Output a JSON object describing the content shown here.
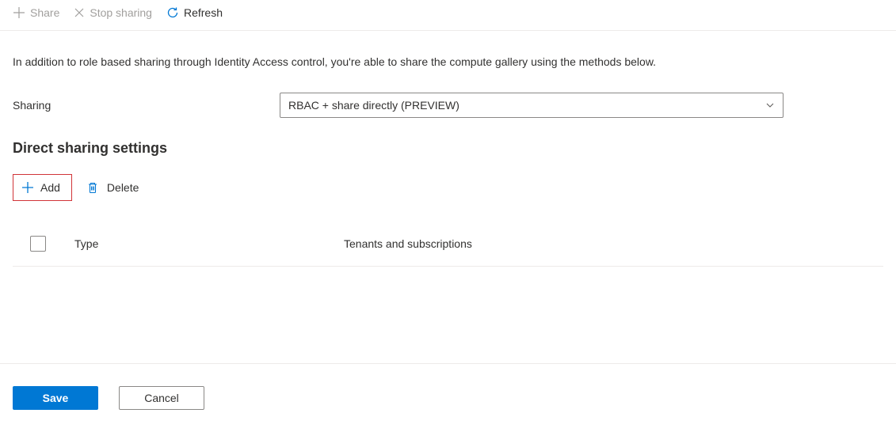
{
  "toolbar": {
    "share_label": "Share",
    "stop_sharing_label": "Stop sharing",
    "refresh_label": "Refresh"
  },
  "description": "In addition to role based sharing through Identity Access control, you're able to share the compute gallery using the methods below.",
  "sharing": {
    "label": "Sharing",
    "selected": "RBAC + share directly (PREVIEW)"
  },
  "section": {
    "heading": "Direct sharing settings",
    "add_label": "Add",
    "delete_label": "Delete"
  },
  "table": {
    "col_type": "Type",
    "col_tenants": "Tenants and subscriptions"
  },
  "footer": {
    "save_label": "Save",
    "cancel_label": "Cancel"
  }
}
